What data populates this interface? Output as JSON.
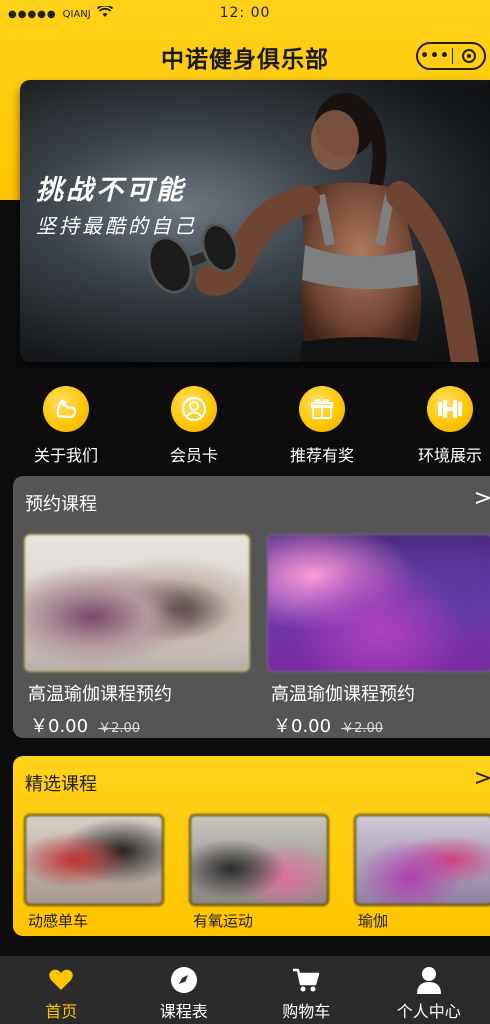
{
  "status": {
    "dots": "●●●●●",
    "carrier": "QIANJ",
    "time": "12: 00"
  },
  "header": {
    "title": "中诺健身俱乐部",
    "more_icon": "more-dots-icon",
    "close_icon": "target-icon"
  },
  "banner": {
    "headline": "挑战不可能",
    "subline": "坚持最酷的自己"
  },
  "quick_nav": [
    {
      "label": "关于我们",
      "icon": "muscle-arm-icon"
    },
    {
      "label": "会员卡",
      "icon": "user-circle-icon"
    },
    {
      "label": "推荐有奖",
      "icon": "gift-icon"
    },
    {
      "label": "环境展示",
      "icon": "dumbbell-icon"
    }
  ],
  "booking": {
    "title": "预约课程",
    "arrow": ">",
    "cards": [
      {
        "name": "高温瑜伽课程预约",
        "price": "￥0.00",
        "original_price": "￥2.00"
      },
      {
        "name": "高温瑜伽课程预约",
        "price": "￥0.00",
        "original_price": "￥2.00"
      }
    ]
  },
  "featured": {
    "title": "精选课程",
    "arrow": ">",
    "cards": [
      {
        "name": "动感单车"
      },
      {
        "name": "有氧运动"
      },
      {
        "name": "瑜伽"
      }
    ]
  },
  "tabbar": [
    {
      "label": "首页",
      "icon": "heart-icon",
      "active": true
    },
    {
      "label": "课程表",
      "icon": "compass-icon",
      "active": false
    },
    {
      "label": "购物车",
      "icon": "cart-icon",
      "active": false
    },
    {
      "label": "个人中心",
      "icon": "person-icon",
      "active": false
    }
  ],
  "colors": {
    "accent": "#ffc400",
    "panel": "#555555",
    "background": "#0d0d0d",
    "tabbar": "#2b2b2b"
  }
}
